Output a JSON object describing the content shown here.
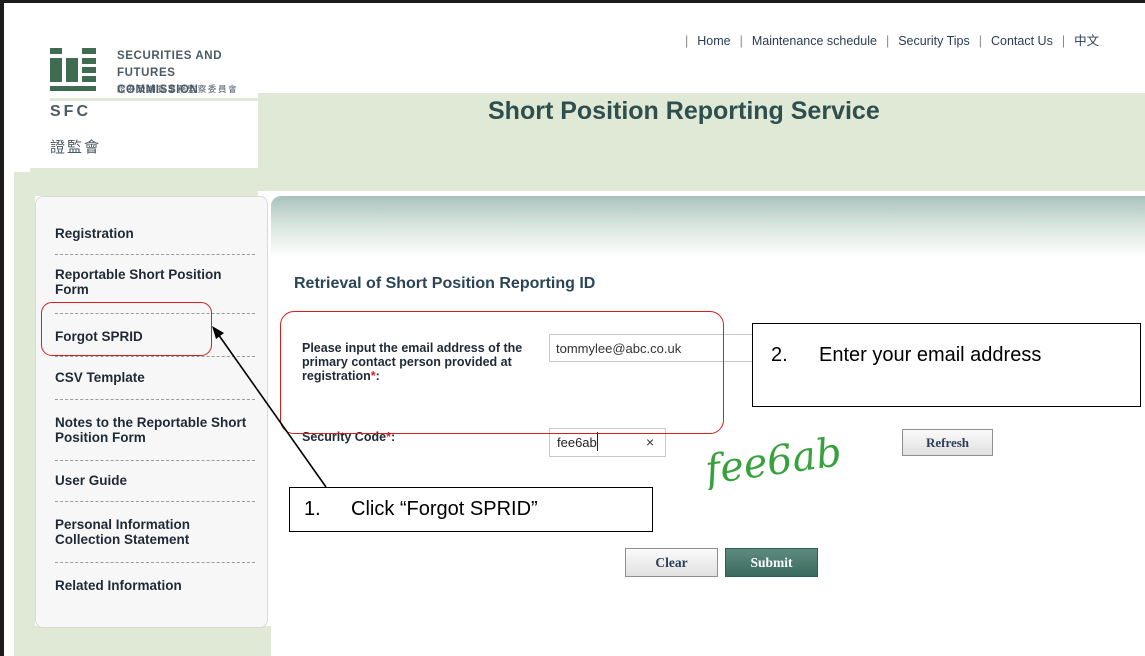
{
  "logo": {
    "line1": "SECURITIES AND",
    "line2": "FUTURES COMMISSION",
    "chinese_full": "證券及期貨事務監察委員會",
    "abbr": "SFC",
    "chinese_short": "證監會"
  },
  "topnav": {
    "items": [
      "Home",
      "Maintenance schedule",
      "Security Tips",
      "Contact Us",
      "中文"
    ]
  },
  "site_title": "Short Position Reporting Service",
  "sidebar": {
    "items": [
      {
        "label": "Registration"
      },
      {
        "label": "Reportable Short Position Form"
      },
      {
        "label": "Forgot SPRID"
      },
      {
        "label": "CSV Template"
      },
      {
        "label": "Notes to the Reportable Short Position Form"
      },
      {
        "label": "User Guide"
      },
      {
        "label": "Personal Information Collection Statement"
      },
      {
        "label": "Related Information"
      }
    ]
  },
  "form": {
    "heading": "Retrieval of Short Position Reporting ID",
    "email_label": "Please input the email address of the primary contact person provided at registration",
    "required_mark": "*",
    "colon": ":",
    "email_value": "tommylee@abc.co.uk",
    "code_label": "Security Code",
    "code_value": "fee6ab",
    "clear_x": "×",
    "captcha_text": "fee6ab",
    "refresh_label": "Refresh",
    "clear_label": "Clear",
    "submit_label": "Submit"
  },
  "annotations": {
    "step1_num": "1.",
    "step1_text": "Click “Forgot SPRID”",
    "step2_num": "2.",
    "step2_text": "Enter your email address",
    "highlight_color": "#d61f1f"
  }
}
